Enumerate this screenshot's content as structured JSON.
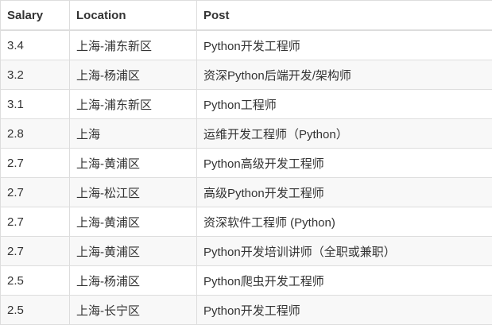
{
  "table": {
    "headers": [
      "Salary",
      "Location",
      "Post"
    ],
    "rows": [
      [
        "3.4",
        "上海-浦东新区",
        "Python开发工程师"
      ],
      [
        "3.2",
        "上海-杨浦区",
        "资深Python后端开发/架构师"
      ],
      [
        "3.1",
        "上海-浦东新区",
        "Python工程师"
      ],
      [
        "2.8",
        "上海",
        "运维开发工程师（Python）"
      ],
      [
        "2.7",
        "上海-黄浦区",
        "Python高级开发工程师"
      ],
      [
        "2.7",
        "上海-松江区",
        "高级Python开发工程师"
      ],
      [
        "2.7",
        "上海-黄浦区",
        "资深软件工程师 (Python)"
      ],
      [
        "2.7",
        "上海-黄浦区",
        "Python开发培训讲师（全职或兼职）"
      ],
      [
        "2.5",
        "上海-杨浦区",
        "Python爬虫开发工程师"
      ],
      [
        "2.5",
        "上海-长宁区",
        "Python开发工程师"
      ]
    ]
  }
}
